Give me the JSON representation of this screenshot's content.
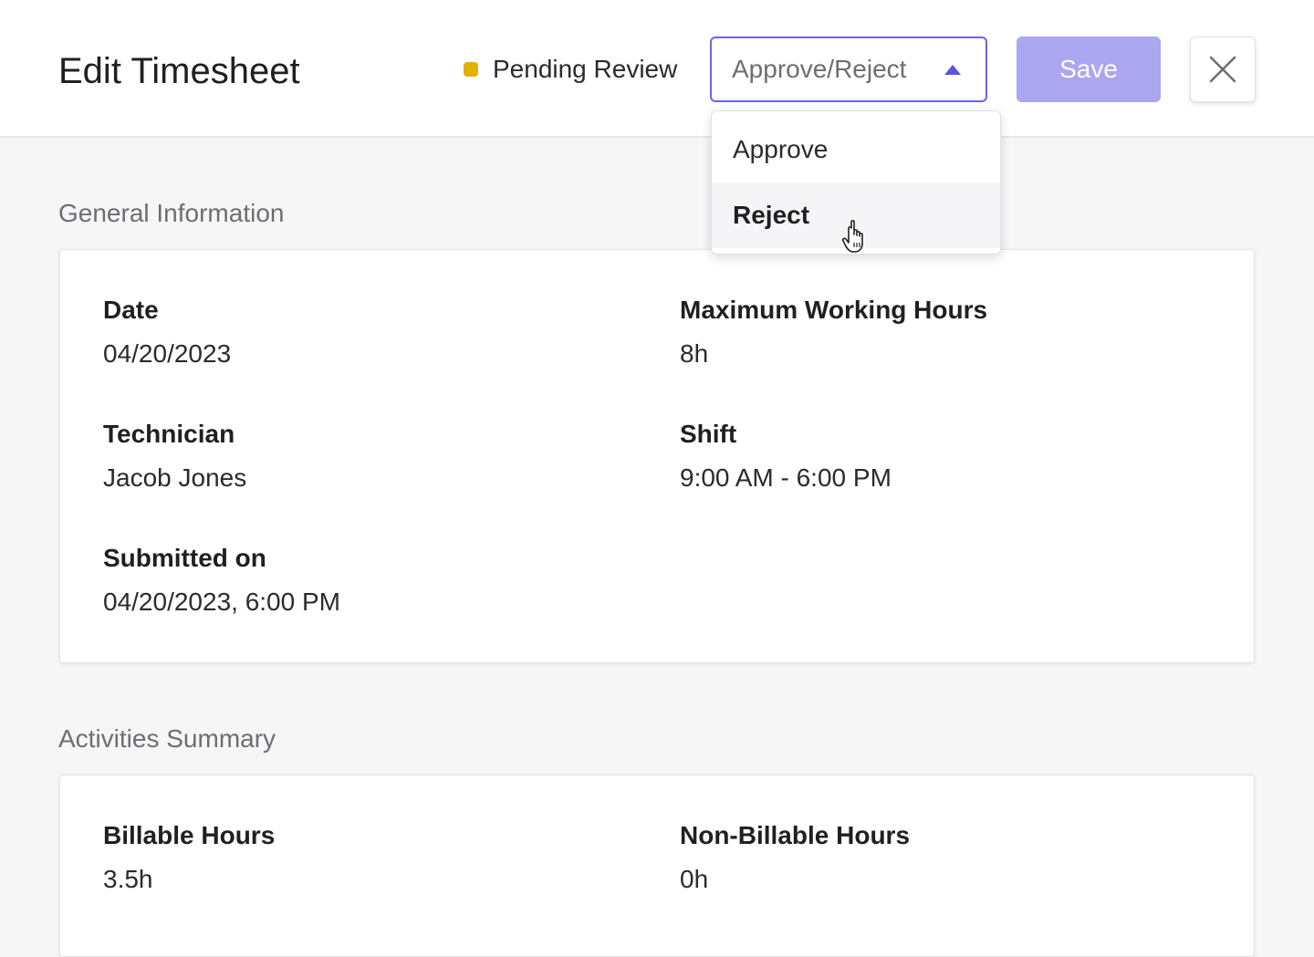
{
  "header": {
    "title": "Edit Timesheet",
    "status": {
      "label": "Pending Review",
      "color": "#e2b007"
    },
    "select": {
      "placeholder": "Approve/Reject",
      "caret_icon": "caret-up-icon"
    },
    "save_label": "Save",
    "close_icon": "close-icon"
  },
  "dropdown": {
    "options": [
      {
        "label": "Approve"
      },
      {
        "label": "Reject"
      }
    ],
    "hovered": "Reject"
  },
  "general": {
    "title": "General Information",
    "fields": {
      "date": {
        "label": "Date",
        "value": "04/20/2023"
      },
      "max_hours": {
        "label": "Maximum Working Hours",
        "value": "8h"
      },
      "technician": {
        "label": "Technician",
        "value": "Jacob Jones"
      },
      "shift": {
        "label": "Shift",
        "value": "9:00 AM - 6:00 PM"
      },
      "submitted": {
        "label": "Submitted on",
        "value": "04/20/2023, 6:00 PM"
      }
    }
  },
  "activities": {
    "title": "Activities Summary",
    "fields": {
      "billable": {
        "label": "Billable Hours",
        "value": "3.5h"
      },
      "non_billable": {
        "label": "Non-Billable Hours",
        "value": "0h"
      }
    }
  },
  "colors": {
    "accent": "#5b52e0",
    "save_disabled": "#aaa6f0",
    "pending": "#e2b007"
  }
}
